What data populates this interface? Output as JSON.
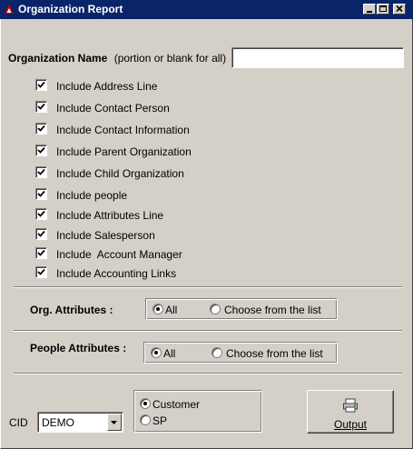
{
  "window": {
    "title": "Organization Report",
    "app_icon": "app-icon",
    "controls": [
      "minimize-icon",
      "maximize-icon",
      "close-icon"
    ]
  },
  "org_name": {
    "label": "Organization Name",
    "hint": "(portion or blank for all)",
    "value": ""
  },
  "options": [
    {
      "label": "Include Address Line",
      "checked": true
    },
    {
      "label": "Include Contact Person",
      "checked": true
    },
    {
      "label": "Include Contact Information",
      "checked": true
    },
    {
      "label": "Include Parent Organization",
      "checked": true
    },
    {
      "label": "Include Child Organization",
      "checked": true
    },
    {
      "label": "Include people",
      "checked": true
    },
    {
      "label": "Include Attributes Line",
      "checked": true
    },
    {
      "label": "Include Salesperson",
      "checked": true
    },
    {
      "label": "Include  Account Manager",
      "checked": true
    },
    {
      "label": "Include Accounting Links",
      "checked": true
    }
  ],
  "org_attributes": {
    "label": "Org. Attributes :",
    "option_all": "All",
    "option_choose": "Choose from the list",
    "selected": "All"
  },
  "people_attributes": {
    "label": "People Attributes :",
    "option_all": "All",
    "option_choose": "Choose from the list",
    "selected": "All"
  },
  "cid": {
    "label": "CID",
    "value": "DEMO"
  },
  "output_type": {
    "option_customer": "Customer",
    "option_sp": "SP",
    "selected": "Customer"
  },
  "output_button": {
    "label": "Output",
    "icon": "printer-icon"
  }
}
